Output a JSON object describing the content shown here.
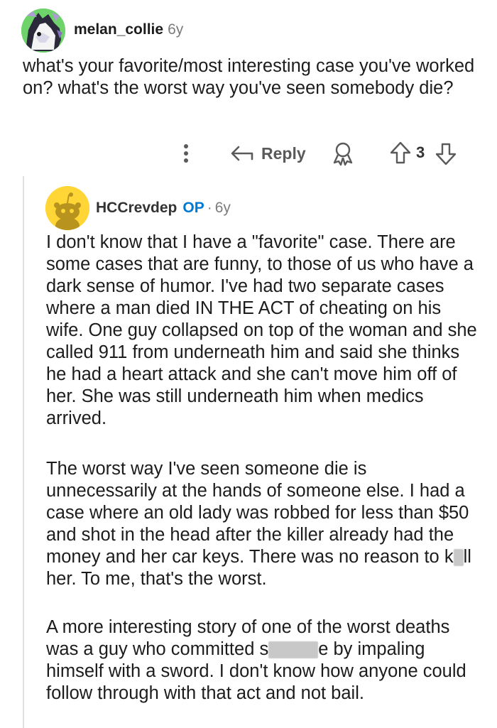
{
  "parent": {
    "username": "melan_collie",
    "age": "6y",
    "text": "what's your favorite/most interesting case you've worked on? what's the worst way you've seen somebody die?",
    "actions": {
      "reply_label": "Reply",
      "vote_count": "3"
    }
  },
  "reply": {
    "username": "HCCrevdep",
    "op_badge": "OP",
    "separator": "·",
    "age": "6y",
    "p1": "I don't know that I have a \"favorite\" case. There are some cases that are funny, to those of us who have a dark sense of humor. I've had two separate cases where a man died IN THE ACT of cheating on his wife. One guy collapsed on top of the woman and she called 911 from underneath him and said she thinks he had a heart attack and she can't move him off of her. She was still underneath him when medics arrived.",
    "p2": {
      "before": "The worst way I've seen someone die is unnecessarily at the hands of someone else. I had a case where an old lady was robbed for less than $50 and shot in the head after the killer already had the money and her car keys. There was no reason to k",
      "after": "ll her. To me, that's the worst."
    },
    "p3": {
      "before": "A more interesting story of one of the worst deaths was a guy who committed s",
      "after": "e by impaling himself with a sword. I don't know how anyone could follow through with that act and not bail."
    }
  },
  "colors": {
    "op_blue": "#0079d3",
    "snoo_yellow": "#ffd635",
    "avatar_green": "#6fd36b"
  },
  "icons": [
    "more-vertical-icon",
    "reply-arrow-icon",
    "award-icon",
    "upvote-arrow-icon",
    "downvote-arrow-icon"
  ]
}
